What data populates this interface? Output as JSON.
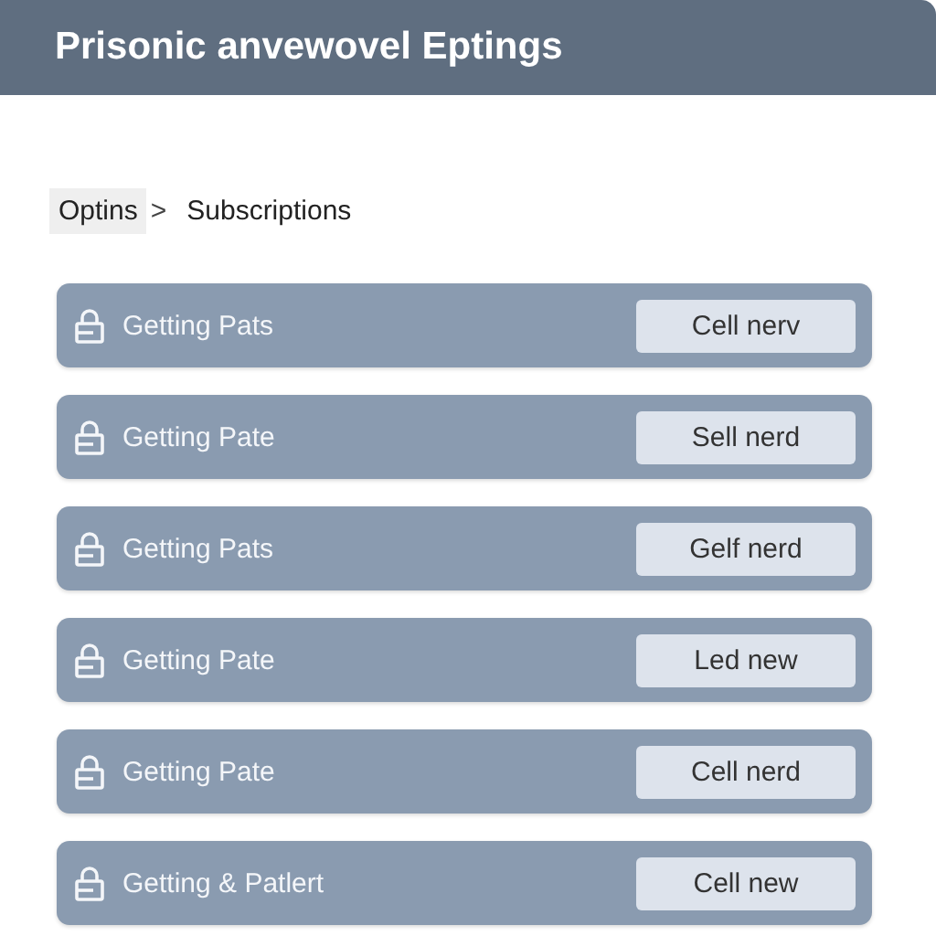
{
  "window": {
    "title": "Prisonic anvewovel Eptings"
  },
  "breadcrumb": [
    "Optins",
    "Subscriptions"
  ],
  "breadcrumb_separator": ">",
  "rows": [
    {
      "label": "Getting Pats",
      "button": "Cell nerv"
    },
    {
      "label": "Getting Pate",
      "button": "Sell nerd"
    },
    {
      "label": "Getting Pats",
      "button": "Gelf nerd"
    },
    {
      "label": "Getting Pate",
      "button": "Led new"
    },
    {
      "label": "Getting Pate",
      "button": "Cell nerd"
    },
    {
      "label": "Getting & Patlert",
      "button": "Cell new"
    }
  ]
}
